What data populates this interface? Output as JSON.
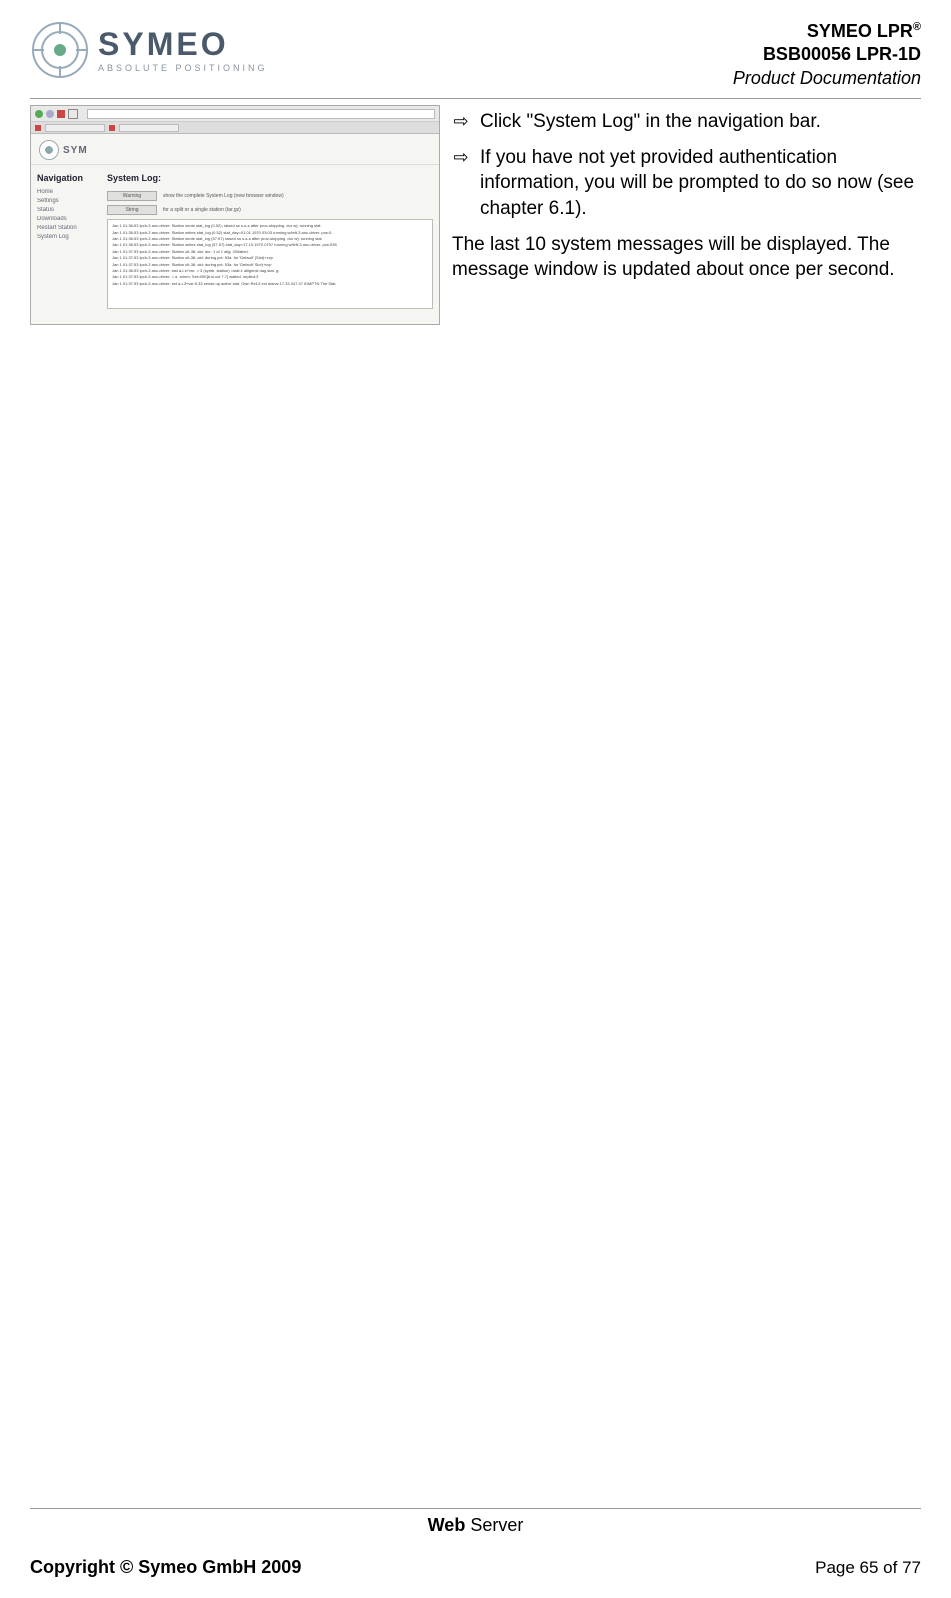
{
  "header": {
    "logo_name": "SYMEO",
    "logo_sub": "ABSOLUTE POSITIONING",
    "line1_pre": "SYMEO LPR",
    "line1_sup": "®",
    "line2": "BSB00056 LPR-1D",
    "line3": "Product Documentation"
  },
  "thumb": {
    "nav_heading": "Navigation",
    "main_heading": "System Log:",
    "nav_items": [
      "Home",
      "Settings",
      "Status",
      "Downloads",
      "Restart Station",
      "System Log"
    ],
    "btn1": "Warning",
    "btn1_txt": "show the complete System Log (new browser window)",
    "btn2": "String",
    "btn2_txt": "for a split or a single station (tar.gz)",
    "log_lines": [
      "Jan 1 01:36:53 lpch-3 anc-driver: Station wrote stat_log (0.52); raised ss s-s-s after proc-stopping. dur w); running stat",
      "Jan 1 01:36:53 lpch-3 anc-driver: Station writes stat_log (0.52) stat_day=01.01.1970 03:03 running w/left-3 anc-driver. pos:0-",
      "Jan 1 01:36:53 lpch-3 anc-driver: Station wrote stat_log (57.57) raised ss s-s-s after proc-stopping. dur w); running stat",
      "Jan 1 01:36:53 lpch-3 anc-driver: Station writes stat_log (57.57) stat_day=17.10.1970 0757 running w/left-3 anc-driver. pos:035",
      "Jan 1 01:37:53 lpch-3 anc-driver: Station ult-38: aid: dur: 1 of 1 allg; 33/failed.",
      "Jan 1 01:37:53 lpch-3 anc-driver: Station ult-38: aid: during pct: 53a. for 'Default' (Slot)+cvp",
      "Jan 1 01:37:53 lpch-3 anc-driver: Station ult-38: aid: during pct: 53a. for 'Default' Slot)+cvp",
      "Jan 1 01:36:53 lpch-3 anc-driver: last a-l-s+vsr:  > 3 (symb. station) <stat:1 alligensl dag stat. g:",
      "Jan 1 01:37:53 lpch-3 anc-driver: = a -rchen: Set=IBS[b.si.col.7.7]  waited. replied:3",
      "Jan 1 01:37:53 lpch-3 anc-driver: set a-l-3+vsr:5.33 sends up active stat. Own Ref-3 ext ddcvs:17.33.347.37 IDMPTN The Stat"
    ]
  },
  "instructions": {
    "item1": "Click \"System Log\" in the navigation bar.",
    "item2": "If you have not yet provided authentication information, you will be prompted to do so now (see chapter 6.1).",
    "para": "The last 10 system messages will be displayed. The message window is updated about once per second."
  },
  "footer": {
    "section_bold": "Web",
    "section_rest": " Server",
    "copyright": "Copyright © Symeo GmbH 2009",
    "page": "Page 65 of 77"
  }
}
